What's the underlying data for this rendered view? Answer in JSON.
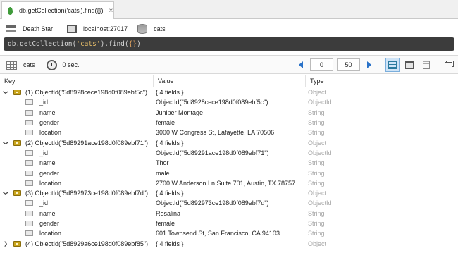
{
  "tab": {
    "title": "db.getCollection('cats').find({})",
    "close": "×"
  },
  "connection": {
    "server": "Death Star",
    "host": "localhost:27017",
    "database": "cats"
  },
  "query": {
    "prefix": "db.getCollection(",
    "arg": "'cats'",
    "mid": ").find(",
    "obj": "{}",
    "suffix": ")"
  },
  "toolbar": {
    "collection": "cats",
    "time": "0 sec.",
    "skip": "0",
    "limit": "50"
  },
  "grid": {
    "headers": {
      "key": "Key",
      "value": "Value",
      "type": "Type"
    },
    "documents": [
      {
        "key": "(1) ObjectId(\"5d8928cece198d0f089ebf5c\")",
        "value": "{ 4 fields }",
        "type": "Object",
        "expanded": true,
        "fields": [
          {
            "key": "_id",
            "value": "ObjectId(\"5d8928cece198d0f089ebf5c\")",
            "type": "ObjectId"
          },
          {
            "key": "name",
            "value": "Juniper Montage",
            "type": "String"
          },
          {
            "key": "gender",
            "value": "female",
            "type": "String"
          },
          {
            "key": "location",
            "value": "3000 W Congress St, Lafayette, LA 70506",
            "type": "String"
          }
        ]
      },
      {
        "key": "(2) ObjectId(\"5d89291ace198d0f089ebf71\")",
        "value": "{ 4 fields }",
        "type": "Object",
        "expanded": true,
        "fields": [
          {
            "key": "_id",
            "value": "ObjectId(\"5d89291ace198d0f089ebf71\")",
            "type": "ObjectId"
          },
          {
            "key": "name",
            "value": "Thor",
            "type": "String"
          },
          {
            "key": "gender",
            "value": "male",
            "type": "String"
          },
          {
            "key": "location",
            "value": "2700 W Anderson Ln Suite 701, Austin, TX 78757",
            "type": "String"
          }
        ]
      },
      {
        "key": "(3) ObjectId(\"5d892973ce198d0f089ebf7d\")",
        "value": "{ 4 fields }",
        "type": "Object",
        "expanded": true,
        "fields": [
          {
            "key": "_id",
            "value": "ObjectId(\"5d892973ce198d0f089ebf7d\")",
            "type": "ObjectId"
          },
          {
            "key": "name",
            "value": "Rosalina",
            "type": "String"
          },
          {
            "key": "gender",
            "value": "female",
            "type": "String"
          },
          {
            "key": "location",
            "value": "601 Townsend St, San Francisco, CA 94103",
            "type": "String"
          }
        ]
      },
      {
        "key": "(4) ObjectId(\"5d8929a6ce198d0f089ebf85\")",
        "value": "{ 4 fields }",
        "type": "Object",
        "expanded": false,
        "fields": []
      }
    ]
  },
  "colors": {
    "accent": "#2a72c8",
    "query_bg": "#3c3c3c",
    "object_icon": "#c9a41b",
    "type_text": "#a8a8a8"
  }
}
